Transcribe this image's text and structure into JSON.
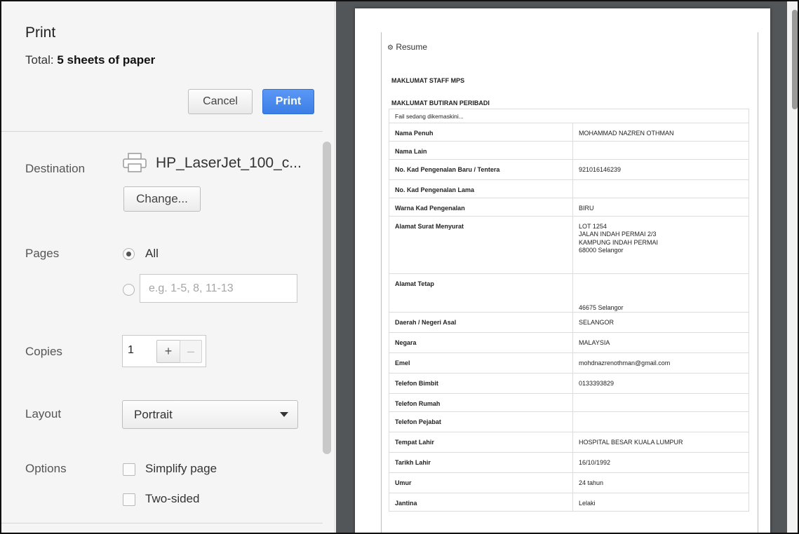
{
  "dialog": {
    "title": "Print",
    "total_prefix": "Total: ",
    "total_value": "5 sheets of paper",
    "cancel_label": "Cancel",
    "print_label": "Print"
  },
  "destination": {
    "label": "Destination",
    "printer_name": "HP_LaserJet_100_c...",
    "change_label": "Change..."
  },
  "pages": {
    "label": "Pages",
    "all_label": "All",
    "range_placeholder": "e.g. 1-5, 8, 11-13"
  },
  "copies": {
    "label": "Copies",
    "value": "1",
    "plus": "+",
    "minus": "–"
  },
  "layout": {
    "label": "Layout",
    "selected": "Portrait"
  },
  "options": {
    "label": "Options",
    "simplify_label": "Simplify page",
    "two_sided_label": "Two-sided"
  },
  "preview": {
    "doc_title": "Resume",
    "section1": "MAKLUMAT STAFF MPS",
    "section2": "MAKLUMAT BUTIRAN PERIBADI",
    "status": "Fail sedang dikemaskini...",
    "rows": [
      {
        "key": "Nama Penuh",
        "value": "MOHAMMAD NAZREN OTHMAN"
      },
      {
        "key": "Nama Lain",
        "value": ""
      },
      {
        "key": "No. Kad Pengenalan Baru / Tentera",
        "value": "921016146239"
      },
      {
        "key": "No. Kad Pengenalan Lama",
        "value": ""
      },
      {
        "key": "Warna Kad Pengenalan",
        "value": "BIRU"
      },
      {
        "key": "Alamat Surat Menyurat",
        "value": "LOT 1254\nJALAN INDAH PERMAI 2/3\nKAMPUNG INDAH PERMAI\n68000 Selangor"
      },
      {
        "key": "Alamat Tetap",
        "value": "\n\n\n46675 Selangor"
      },
      {
        "key": "Daerah / Negeri Asal",
        "value": "SELANGOR"
      },
      {
        "key": "Negara",
        "value": "MALAYSIA"
      },
      {
        "key": "Emel",
        "value": "mohdnazrenothman@gmail.com"
      },
      {
        "key": "Telefon Bimbit",
        "value": "0133393829"
      },
      {
        "key": "Telefon Rumah",
        "value": ""
      },
      {
        "key": "Telefon Pejabat",
        "value": ""
      },
      {
        "key": "Tempat Lahir",
        "value": "HOSPITAL BESAR KUALA LUMPUR"
      },
      {
        "key": "Tarikh Lahir",
        "value": "16/10/1992"
      },
      {
        "key": "Umur",
        "value": "24 tahun"
      },
      {
        "key": "Jantina",
        "value": "Lelaki"
      }
    ]
  },
  "colors": {
    "print_button": "#3c7ee6",
    "preview_background": "#525659",
    "sidebar_background": "#f5f5f5"
  }
}
